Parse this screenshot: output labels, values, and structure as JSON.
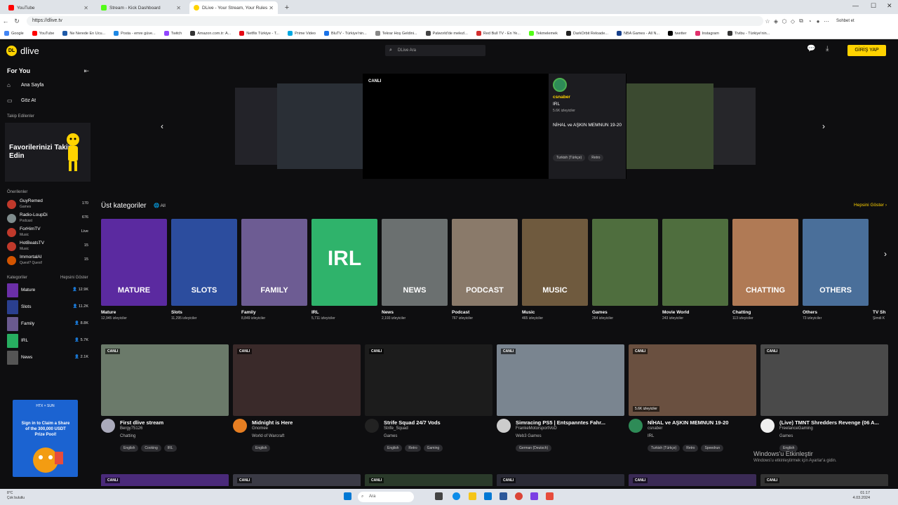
{
  "browser": {
    "tabs": [
      {
        "title": "YouTube",
        "color": "#ff0000"
      },
      {
        "title": "Stream - Kick Dashboard",
        "color": "#53fc18"
      },
      {
        "title": "DLive - Your Stream, Your Rules",
        "color": "#ffd300",
        "active": true
      }
    ],
    "url": "https://dlive.tv",
    "profile_label": "Sohbet et",
    "bookmarks": [
      "Google",
      "YouTube",
      "Ne Nerede En Ucu...",
      "Posta - emre güve...",
      "Twitch",
      "Amazon.com.tr: A...",
      "Netflix Türkiye - T...",
      "Prime Video",
      "BluTV - Türkiye'nin...",
      "Tekrar Hoş Geldini...",
      "Palworld'de melezl...",
      "Red Bull TV - En Ye...",
      "Tekmelemek",
      "DarkOrbit Reloade...",
      "NBA Games - All N...",
      "twetter",
      "Instagram",
      "Tivibu - Türkiye'nin..."
    ]
  },
  "header": {
    "logo_text": "dlive",
    "search_placeholder": "DLive Ara",
    "login_label": "GİRİŞ YAP"
  },
  "sidebar": {
    "title": "For You",
    "nav": [
      {
        "label": "Ana Sayfa",
        "icon": "home-icon"
      },
      {
        "label": "Göz At",
        "icon": "browse-icon"
      }
    ],
    "followed_label": "Takip Edilenler",
    "promo_text": "Favorilerinizi Takip Edin",
    "recommended_label": "Önerilenler",
    "recommended": [
      {
        "name": "GuyRemed",
        "category": "Games",
        "viewers": "170",
        "color": "#c0392b"
      },
      {
        "name": "Radio-LoupDi",
        "category": "Podcast",
        "viewers": "676",
        "color": "#7f8c8d"
      },
      {
        "name": "ForHimTV",
        "category": "Music",
        "viewers": "Live",
        "color": "#c0392b"
      },
      {
        "name": "HotBeatsTV",
        "category": "Music",
        "viewers": "15",
        "color": "#c0392b"
      },
      {
        "name": "ImmortalAI",
        "category": "Quest? Quest!",
        "viewers": "15",
        "color": "#d35400"
      }
    ],
    "categories_label": "Kategoriler",
    "categories_more": "Hepsini Göster",
    "categories": [
      {
        "name": "Mature",
        "viewers": "12.9K",
        "color": "#6b2fa8"
      },
      {
        "name": "Slots",
        "viewers": "11.2K",
        "color": "#2a3f8f"
      },
      {
        "name": "Family",
        "viewers": "8.8K",
        "color": "#6a5a8f"
      },
      {
        "name": "IRL",
        "viewers": "5.7K",
        "color": "#27ae60"
      },
      {
        "name": "News",
        "viewers": "2.1K",
        "color": "#555"
      }
    ],
    "ad": {
      "brand": "HTX × SUN",
      "text": "Sign in to Claim a Share of the 300,000 USDT Prize Pool!"
    }
  },
  "hero": {
    "live_label": "CANLI",
    "channel": "csnaber",
    "category": "IRL",
    "viewers": "5.6K izleyiciler",
    "title": "NİHAL ve AŞKIN MEMNUN 19-20",
    "tags": [
      "Turkish (Türkçe)",
      "Retro"
    ]
  },
  "categories_section": {
    "title": "Üst kategoriler",
    "all_label": "All",
    "more_label": "Hepsini Göster",
    "items": [
      {
        "big": "MATURE",
        "name": "Mature",
        "viewers": "12,945 izleyiciler",
        "color": "#5b2aa0"
      },
      {
        "big": "SLOTS",
        "name": "Slots",
        "viewers": "11,295 izleyiciler",
        "color": "#2c4d9e"
      },
      {
        "big": "FAMILY",
        "name": "Family",
        "viewers": "8,849 izleyiciler",
        "color": "#6d5c93"
      },
      {
        "big": "IRL",
        "name": "IRL",
        "viewers": "5,711 izleyiciler",
        "color": "#2fb36b"
      },
      {
        "big": "NEWS",
        "name": "News",
        "viewers": "2,193 izleyiciler",
        "color": "#6b7070"
      },
      {
        "big": "PODCAST",
        "name": "Podcast",
        "viewers": "767 izleyiciler",
        "color": "#8a7a6a"
      },
      {
        "big": "MUSIC",
        "name": "Music",
        "viewers": "465 izleyiciler",
        "color": "#6f5a3e"
      },
      {
        "big": "",
        "name": "Games",
        "viewers": "264 izleyiciler",
        "color": "#4f6e3e"
      },
      {
        "big": "",
        "name": "Movie World",
        "viewers": "243 izleyiciler",
        "color": "#4f6e3e"
      },
      {
        "big": "CHATTING",
        "name": "Chatting",
        "viewers": "113 izleyiciler",
        "color": "#b07a55"
      },
      {
        "big": "OTHERS",
        "name": "Others",
        "viewers": "73 izleyiciler",
        "color": "#4a6f9a"
      }
    ],
    "partial": {
      "name": "TV Sh",
      "viewers": "Şimdi K"
    }
  },
  "streams": [
    {
      "live": "CANLI",
      "title": "First dlive stream",
      "channel": "Bergy75126",
      "category": "Chatting",
      "tags": [
        "English",
        "Cooking",
        "IRL"
      ],
      "color": "#6b7a6a",
      "av": "#aab"
    },
    {
      "live": "CANLI",
      "title": "Midnight is Here",
      "channel": "Gnomee",
      "category": "World of Warcraft",
      "tags": [
        "English"
      ],
      "color": "#3a2a2a",
      "av": "#e67e22"
    },
    {
      "live": "CANLI",
      "title": "Strife Squad 24/7 Vods",
      "channel": "Strife_Squad",
      "category": "Games",
      "tags": [
        "English",
        "Retro",
        "Gaming"
      ],
      "color": "#1c1c1c",
      "av": "#222"
    },
    {
      "live": "CANLI",
      "title": "Simracing PS5 | Entspanntes Fahr...",
      "channel": "FrankeMotorsportVoD",
      "category": "Web3 Games",
      "tags": [
        "German (Deutsch)"
      ],
      "color": "#7a8590",
      "av": "#ccc"
    },
    {
      "live": "CANLI",
      "viewers": "5.6K izleyiciler",
      "title": "NİHAL ve AŞKIN MEMNUN 19-20",
      "channel": "csnaber",
      "category": "IRL",
      "tags": [
        "Turkish (Türkçe)",
        "Retro",
        "Speedrun"
      ],
      "color": "#6a5040",
      "av": "#2e8b57"
    },
    {
      "live": "CANLI",
      "title": "(Live) TMNT Shredders Revenge (06 A...",
      "channel": "FreelanceGaming",
      "category": "Games",
      "tags": [
        "English"
      ],
      "color": "#4a4a4a",
      "av": "#eee"
    }
  ],
  "second_row_live": "CANLI",
  "windows": {
    "activate_title": "Windows'u Etkinleştir",
    "activate_sub": "Windows'u etkinleştirmek için Ayarlar'a gidin.",
    "weather_temp": "8°C",
    "weather_desc": "Çok bulutlu",
    "search": "Ara",
    "time": "01:17",
    "date": "4.03.2024"
  }
}
